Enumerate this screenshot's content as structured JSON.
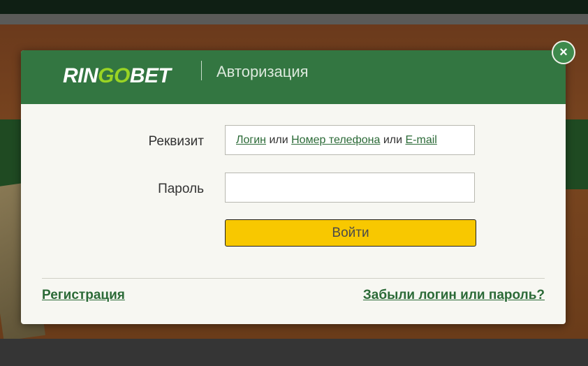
{
  "brand": {
    "logo_prefix": "RIN",
    "logo_highlight": "GO",
    "logo_suffix": "BET"
  },
  "modal": {
    "title": "Авторизация",
    "close_icon": "×"
  },
  "form": {
    "login_label": "Реквизит",
    "login_placeholder": {
      "part1": "Логин",
      "sep1": " или ",
      "part2": "Номер телефона",
      "sep2": " или ",
      "part3": "E-mail"
    },
    "password_label": "Пароль",
    "password_value": "",
    "submit_label": "Войти"
  },
  "footer": {
    "register_link": "Регистрация",
    "forgot_link": "Забыли логин или пароль?"
  },
  "colors": {
    "header_green": "#337641",
    "logo_accent": "#9ad424",
    "link_green": "#2b6a37",
    "button_yellow": "#f8c800"
  }
}
